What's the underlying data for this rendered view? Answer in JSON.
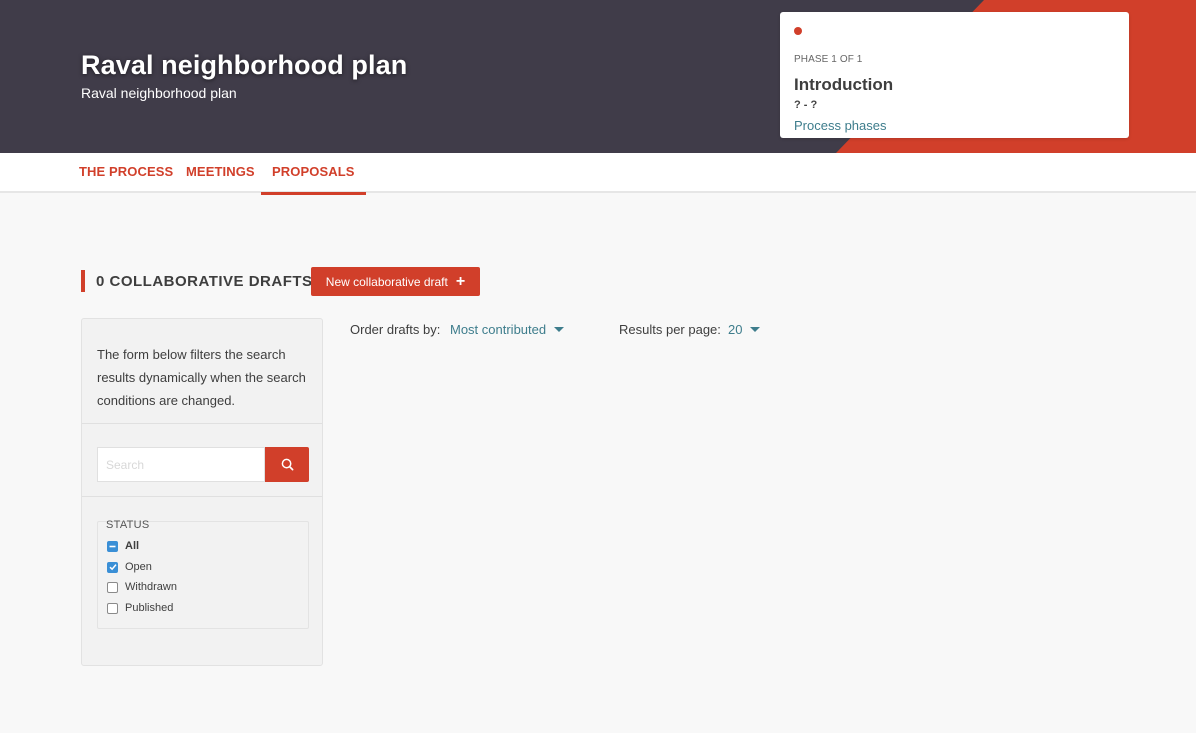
{
  "header": {
    "title": "Raval neighborhood plan",
    "subtitle": "Raval neighborhood plan",
    "accent_color": "#d13f2a",
    "background_color": "#403c49"
  },
  "phase": {
    "step": "PHASE 1 OF 1",
    "name": "Introduction",
    "dates": "? - ?",
    "link_label": "Process phases"
  },
  "tabs": [
    {
      "label": "THE PROCESS",
      "active": false
    },
    {
      "label": "MEETINGS",
      "active": false
    },
    {
      "label": "PROPOSALS",
      "active": true
    }
  ],
  "section": {
    "title": "0 COLLABORATIVE DRAFTS",
    "new_button_label": "New collaborative draft",
    "new_button_icon": "plus-icon"
  },
  "filters": {
    "description": "The form below filters the search results dynamically when the search conditions are changed.",
    "search_placeholder": "Search",
    "search_icon": "search-icon",
    "status": {
      "legend": "STATUS",
      "options": [
        {
          "label": "All",
          "state": "indeterminate"
        },
        {
          "label": "Open",
          "state": "checked"
        },
        {
          "label": "Withdrawn",
          "state": "unchecked"
        },
        {
          "label": "Published",
          "state": "unchecked"
        }
      ]
    }
  },
  "ordering": {
    "order_label": "Order drafts by:",
    "order_value": "Most contributed",
    "per_page_label": "Results per page:",
    "per_page_value": "20"
  }
}
